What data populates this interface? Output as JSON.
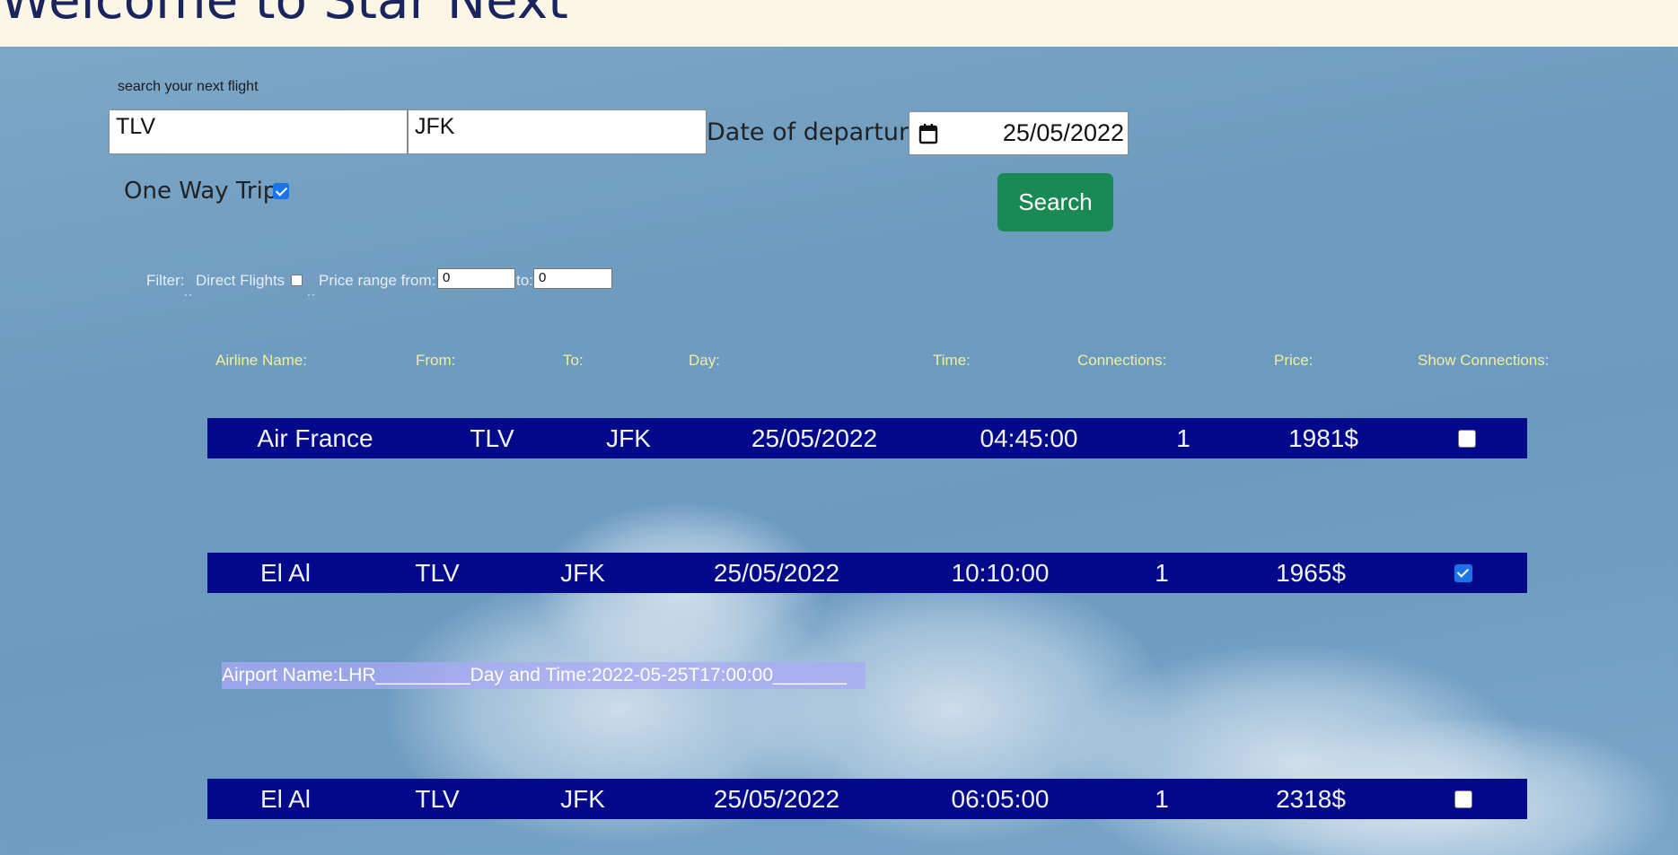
{
  "header": {
    "title": "Welcome to Star Next"
  },
  "search": {
    "label": "search your next flight",
    "from_value": "TLV",
    "to_value": "JFK",
    "date_label": "Date of departure",
    "date_value": "25/05/2022",
    "one_way_label": "One Way Trip",
    "one_way_checked": true,
    "search_button_label": "Search"
  },
  "filter": {
    "label": "Filter:",
    "direct_flights_label": "Direct Flights",
    "price_range_label": "Price range from:",
    "price_from": "0",
    "to_label": "to:",
    "price_to": "0"
  },
  "table": {
    "columns": [
      "Airline Name:",
      "From:",
      "To:",
      "Day:",
      "Time:",
      "Connections:",
      "Price:",
      "Show Connections:"
    ],
    "rows": [
      {
        "airline": "Air France",
        "from": "TLV",
        "to": "JFK",
        "day": "25/05/2022",
        "time": "04:45:00",
        "connections": "1",
        "price": "1981$",
        "show_connections": false
      },
      {
        "airline": "El Al",
        "from": "TLV",
        "to": "JFK",
        "day": "25/05/2022",
        "time": "10:10:00",
        "connections": "1",
        "price": "1965$",
        "show_connections": true
      },
      {
        "airline": "El Al",
        "from": "TLV",
        "to": "JFK",
        "day": "25/05/2022",
        "time": "06:05:00",
        "connections": "1",
        "price": "2318$",
        "show_connections": false
      }
    ]
  },
  "connection_detail": {
    "text": "Airport Name:LHR_________Day and Time:2022-05-25T17:00:00_______"
  },
  "colors": {
    "header_bg": "#fbf6e6",
    "title": "#1a2560",
    "row_bg": "#020a8b",
    "search_button": "#1a8a55",
    "column_header": "#f2ee9c",
    "connection_bg": "#aaaaf5"
  }
}
